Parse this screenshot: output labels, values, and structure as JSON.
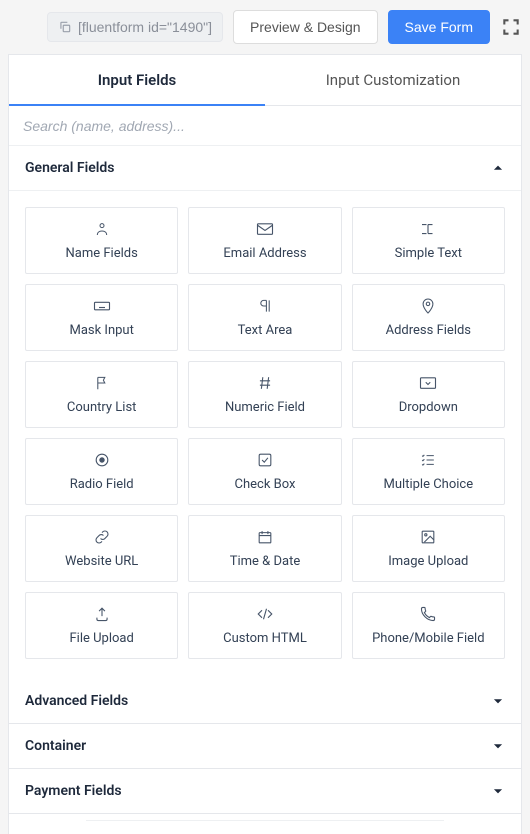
{
  "topbar": {
    "shortcode": "[fluentform id=\"1490\"]",
    "preview_label": "Preview & Design",
    "save_label": "Save Form"
  },
  "tabs": {
    "input_fields": "Input Fields",
    "input_customization": "Input Customization"
  },
  "search": {
    "placeholder": "Search (name, address)..."
  },
  "sections": {
    "general": {
      "title": "General Fields",
      "expanded": true,
      "fields": [
        {
          "label": "Name Fields",
          "icon": "user"
        },
        {
          "label": "Email Address",
          "icon": "mail"
        },
        {
          "label": "Simple Text",
          "icon": "text-cursor"
        },
        {
          "label": "Mask Input",
          "icon": "keyboard"
        },
        {
          "label": "Text Area",
          "icon": "paragraph"
        },
        {
          "label": "Address Fields",
          "icon": "pin"
        },
        {
          "label": "Country List",
          "icon": "flag"
        },
        {
          "label": "Numeric Field",
          "icon": "hash"
        },
        {
          "label": "Dropdown",
          "icon": "select"
        },
        {
          "label": "Radio Field",
          "icon": "circle-dot"
        },
        {
          "label": "Check Box",
          "icon": "check"
        },
        {
          "label": "Multiple Choice",
          "icon": "list-check"
        },
        {
          "label": "Website URL",
          "icon": "link"
        },
        {
          "label": "Time & Date",
          "icon": "calendar"
        },
        {
          "label": "Image Upload",
          "icon": "image"
        },
        {
          "label": "File Upload",
          "icon": "upload"
        },
        {
          "label": "Custom HTML",
          "icon": "code"
        },
        {
          "label": "Phone/Mobile Field",
          "icon": "phone"
        }
      ]
    },
    "advanced": {
      "title": "Advanced Fields",
      "expanded": false
    },
    "container": {
      "title": "Container",
      "expanded": false
    },
    "payment": {
      "title": "Payment Fields",
      "expanded": false
    }
  }
}
